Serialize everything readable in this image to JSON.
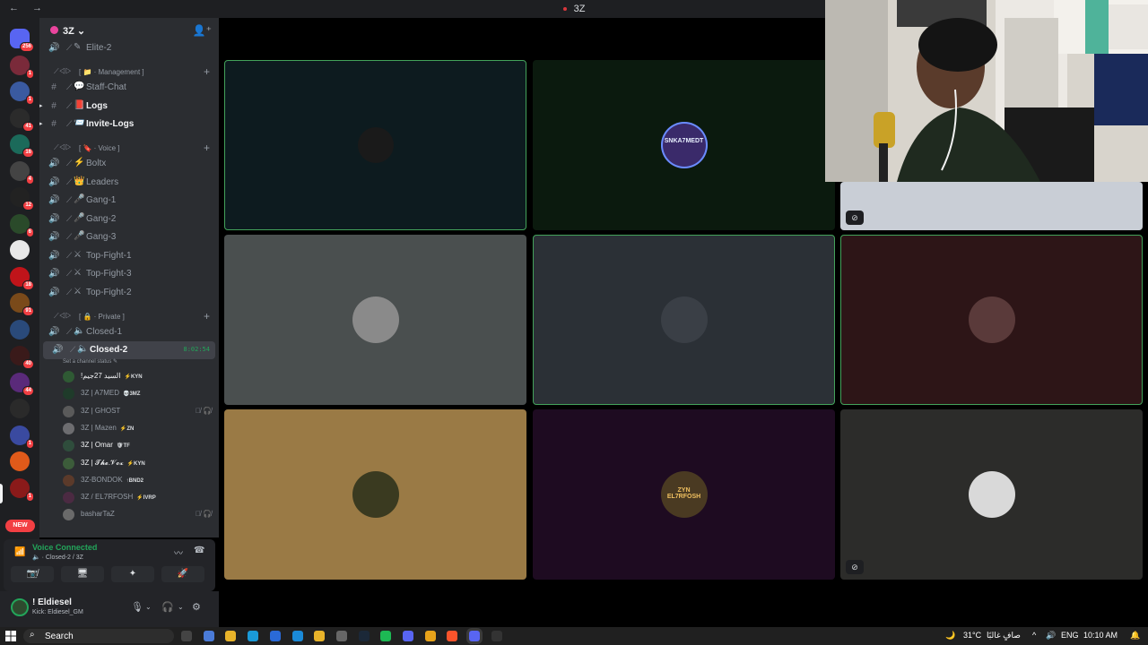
{
  "window": {
    "title": "3Z",
    "nav": "←  →"
  },
  "rail": {
    "badges": [
      "256",
      "1",
      "1",
      "41",
      "16",
      "4",
      "12",
      "6",
      "18",
      "91",
      "40",
      "44",
      "1",
      "1"
    ],
    "new_label": "NEW"
  },
  "guild": {
    "name": "3Z ⌄"
  },
  "sidebar": {
    "top_channel": "Elite-2",
    "categories": {
      "management": "[ 📁 · Management ]",
      "voice": "[ 🔖 · Voice ]",
      "private": "[ 🔒 · Private ]"
    },
    "text_channels": [
      {
        "name": "Staff-Chat",
        "emoji": "💬"
      },
      {
        "name": "Logs",
        "emoji": "📕"
      },
      {
        "name": "Invite-Logs",
        "emoji": "📨"
      }
    ],
    "voice_channels": [
      {
        "name": "Boltx",
        "emoji": "⚡"
      },
      {
        "name": "Leaders",
        "emoji": "👑"
      },
      {
        "name": "Gang-1",
        "emoji": "🎤"
      },
      {
        "name": "Gang-2",
        "emoji": "🎤"
      },
      {
        "name": "Gang-3",
        "emoji": "🎤"
      },
      {
        "name": "Top-Fight-1",
        "emoji": "⚔"
      },
      {
        "name": "Top-Fight-3",
        "emoji": "⚔"
      },
      {
        "name": "Top-Fight-2",
        "emoji": "⚔"
      }
    ],
    "private_channels": [
      {
        "name": "Closed-1",
        "emoji": "🔈"
      },
      {
        "name": "Closed-2",
        "emoji": "🔈",
        "timer": "8:02:54"
      }
    ],
    "channel_status": "Set a channel status ✎",
    "members": [
      {
        "name": "!السيد 27جيم",
        "tag": "⚡KYN",
        "bright": true,
        "color": "#2f5a34"
      },
      {
        "name": "3Z | A7MED",
        "tag": "💀3MZ",
        "bright": false,
        "color": "#1f3b2a"
      },
      {
        "name": "3Z | GHOST",
        "tag": "",
        "bright": false,
        "color": "#5a5a5a",
        "mutes": "🎙̸ 🎧̸"
      },
      {
        "name": "3Z | Mazen",
        "tag": "⚡ZN",
        "bright": false,
        "color": "#6d6d70"
      },
      {
        "name": "3Z | Omar",
        "tag": "🛡TF",
        "bright": true,
        "color": "#2f4d3c"
      },
      {
        "name": "3Z | 𝓣𝓱𝓮.𝓥𝓸𝔁",
        "tag": "⚡KYN",
        "bright": true,
        "color": "#3c5c3a"
      },
      {
        "name": "3Z-BONDOK",
        "tag": "↑BND2",
        "bright": false,
        "color": "#5b3a2a"
      },
      {
        "name": "3Z / EL7RFOSH",
        "tag": "⚡IVRP",
        "bright": false,
        "color": "#4b2a42"
      },
      {
        "name": "basharTaZ",
        "tag": "",
        "bright": false,
        "color": "#6a6a6a",
        "mutes": "🎙̸ 🎧̸"
      }
    ]
  },
  "voice_panel": {
    "status": "Voice Connected",
    "location": "🔈 · Closed-2 / 3Z",
    "buttons": [
      "📷̸",
      "🖥",
      "✦",
      "🚀"
    ]
  },
  "user_panel": {
    "name": "! Eldiesel",
    "status": "Kick: Eldiesel_GM"
  },
  "tiles": [
    {
      "bg": "#0d1b1f",
      "speaking": true,
      "avatar_bg": "#1a1a1a",
      "avatar_text": "",
      "muted": false
    },
    {
      "bg": "#0b1a0e",
      "speaking": false,
      "avatar_bg": "#3a2a6a",
      "avatar_text": "SNKA7MEDT",
      "muted": false
    },
    {
      "bg": "#c9ced6",
      "speaking": false,
      "avatar_bg": "#c9ced6",
      "avatar_text": "",
      "muted": true
    },
    {
      "bg": "#4a4f4f",
      "speaking": false,
      "avatar_bg": "#8a8a8a",
      "avatar_text": "",
      "muted": false
    },
    {
      "bg": "#2b3036",
      "speaking": true,
      "avatar_bg": "#3a3f46",
      "avatar_text": "",
      "muted": false
    },
    {
      "bg": "#2d1517",
      "speaking": true,
      "avatar_bg": "#5a3a3a",
      "avatar_text": "",
      "muted": false
    },
    {
      "bg": "#9a7a45",
      "speaking": false,
      "avatar_bg": "#3a3a20",
      "avatar_text": "",
      "muted": false
    },
    {
      "bg": "#1e0b21",
      "speaking": false,
      "avatar_bg": "#4a3a22",
      "avatar_text": "ZYN EL7RFOSH",
      "muted": false
    },
    {
      "bg": "#2c2c2a",
      "speaking": false,
      "avatar_bg": "#d9d9d9",
      "avatar_text": "",
      "muted": true
    }
  ],
  "taskbar": {
    "search": "Search",
    "weather": "31°C",
    "weather_desc": "صافٍ غالبًا",
    "lang": "ENG",
    "time": "10:10 AM"
  }
}
